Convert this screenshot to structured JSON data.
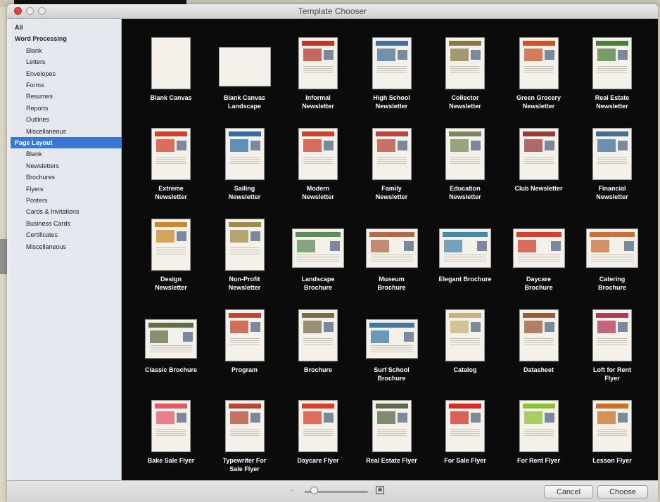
{
  "window": {
    "title": "Template Chooser"
  },
  "sidebar": {
    "items": [
      {
        "label": "All",
        "level": "h"
      },
      {
        "label": "Word Processing",
        "level": "h"
      },
      {
        "label": "Blank",
        "level": "c"
      },
      {
        "label": "Letters",
        "level": "c"
      },
      {
        "label": "Envelopes",
        "level": "c"
      },
      {
        "label": "Forms",
        "level": "c"
      },
      {
        "label": "Resumes",
        "level": "c"
      },
      {
        "label": "Reports",
        "level": "c"
      },
      {
        "label": "Outlines",
        "level": "c"
      },
      {
        "label": "Miscellaneous",
        "level": "c"
      },
      {
        "label": "Page Layout",
        "level": "h",
        "selected": true
      },
      {
        "label": "Blank",
        "level": "c"
      },
      {
        "label": "Newsletters",
        "level": "c"
      },
      {
        "label": "Brochures",
        "level": "c"
      },
      {
        "label": "Flyers",
        "level": "c"
      },
      {
        "label": "Posters",
        "level": "c"
      },
      {
        "label": "Cards & Invitations",
        "level": "c"
      },
      {
        "label": "Business Cards",
        "level": "c"
      },
      {
        "label": "Certificates",
        "level": "c"
      },
      {
        "label": "Miscellaneous",
        "level": "c"
      }
    ]
  },
  "templates": [
    [
      {
        "name": "Blank Canvas",
        "shape": "port",
        "accent": "#ffffff",
        "kind": "blank"
      },
      {
        "name": "Blank Canvas\nLandscape",
        "shape": "land",
        "accent": "#ffffff",
        "kind": "blank"
      },
      {
        "name": "Informal\nNewsletter",
        "shape": "port",
        "accent": "#b43a32"
      },
      {
        "name": "High School\nNewsletter",
        "shape": "port",
        "accent": "#4a6f98"
      },
      {
        "name": "Collector\nNewsletter",
        "shape": "port",
        "accent": "#8a7a4a"
      },
      {
        "name": "Green Grocery\nNewsletter",
        "shape": "port",
        "accent": "#c8552c"
      },
      {
        "name": "Real Estate\nNewsletter",
        "shape": "port",
        "accent": "#4f7d3f"
      }
    ],
    [
      {
        "name": "Extreme\nNewsletter",
        "shape": "port",
        "accent": "#d6402a"
      },
      {
        "name": "Sailing\nNewsletter",
        "shape": "port",
        "accent": "#2f6fa6"
      },
      {
        "name": "Modern\nNewsletter",
        "shape": "port",
        "accent": "#d0402d"
      },
      {
        "name": "Family\nNewsletter",
        "shape": "port",
        "accent": "#b9463c"
      },
      {
        "name": "Education\nNewsletter",
        "shape": "port",
        "accent": "#7a8a5a"
      },
      {
        "name": "Club Newsletter",
        "shape": "port",
        "accent": "#9b3b3b"
      },
      {
        "name": "Financial\nNewsletter",
        "shape": "port",
        "accent": "#3f6f9a"
      }
    ],
    [
      {
        "name": "Design\nNewsletter",
        "shape": "port",
        "accent": "#c98a2e"
      },
      {
        "name": "Non-Profit\nNewsletter",
        "shape": "port",
        "accent": "#a0894a"
      },
      {
        "name": "Landscape\nBrochure",
        "shape": "land",
        "accent": "#5f8a5c"
      },
      {
        "name": "Museum\nBrochure",
        "shape": "land",
        "accent": "#b06a4a"
      },
      {
        "name": "Elegant Brochure",
        "shape": "land",
        "accent": "#4a86a6"
      },
      {
        "name": "Daycare\nBrochure",
        "shape": "land",
        "accent": "#d2412f"
      },
      {
        "name": "Catering\nBrochure",
        "shape": "land",
        "accent": "#c9703a"
      }
    ],
    [
      {
        "name": "Classic Brochure",
        "shape": "land",
        "accent": "#5f6f45"
      },
      {
        "name": "Program",
        "shape": "port",
        "accent": "#c0452e"
      },
      {
        "name": "Brochure",
        "shape": "port",
        "accent": "#7a6b4a"
      },
      {
        "name": "Surf School\nBrochure",
        "shape": "land",
        "accent": "#3f7aa6"
      },
      {
        "name": "Catalog",
        "shape": "port",
        "accent": "#c8b27a"
      },
      {
        "name": "Datasheet",
        "shape": "port",
        "accent": "#9a5a3a"
      },
      {
        "name": "Loft for Rent\nFlyer",
        "shape": "port",
        "accent": "#b03a5a"
      }
    ],
    [
      {
        "name": "Bake Sale Flyer",
        "shape": "port",
        "accent": "#e05a6a"
      },
      {
        "name": "Typewriter For\nSale Flyer",
        "shape": "port",
        "accent": "#b04a3a"
      },
      {
        "name": "Daycare Flyer",
        "shape": "port",
        "accent": "#d8402e"
      },
      {
        "name": "Real Estate Flyer",
        "shape": "port",
        "accent": "#5a6a4a"
      },
      {
        "name": "For Sale Flyer",
        "shape": "port",
        "accent": "#d0302a"
      },
      {
        "name": "For Rent Flyer",
        "shape": "port",
        "accent": "#8fbf3a"
      },
      {
        "name": "Lesson Flyer",
        "shape": "port",
        "accent": "#c8702a"
      }
    ]
  ],
  "footer": {
    "zoom_small_glyph": "▫",
    "zoom_large_glyph": "▣",
    "zoom_level": 0.1,
    "cancel_label": "Cancel",
    "choose_label": "Choose"
  }
}
